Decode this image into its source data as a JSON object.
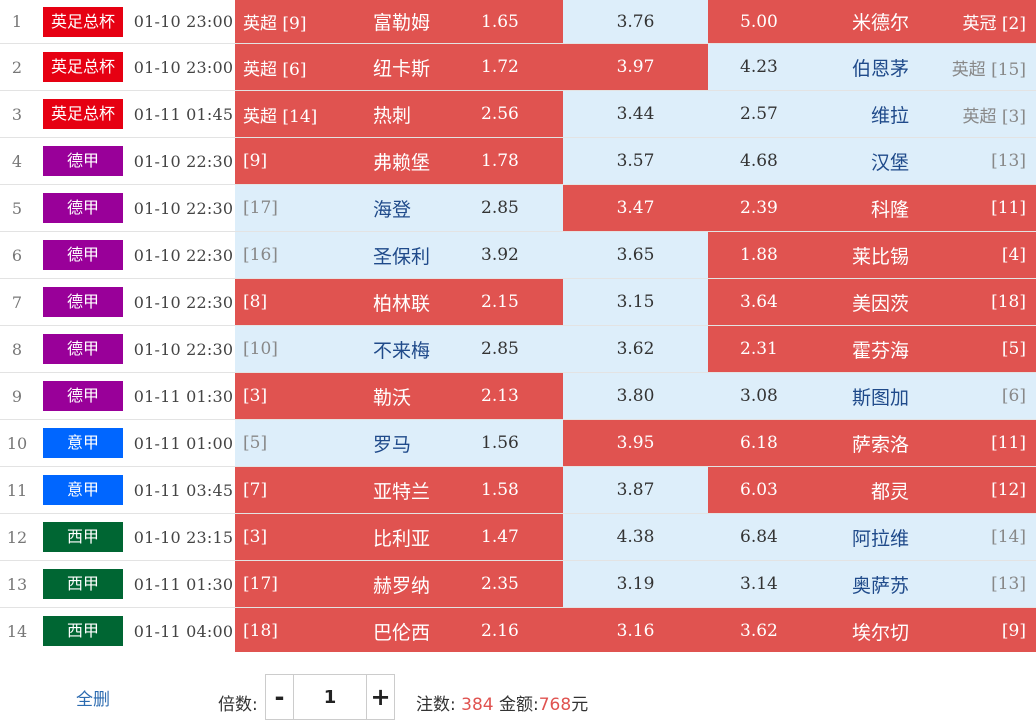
{
  "colors": {
    "highlight_red": "#e05350",
    "light_blue": "#ddeefa",
    "league": {
      "英足总杯": "#e60012",
      "德甲": "#990099",
      "意甲": "#0066ff",
      "西甲": "#006633"
    }
  },
  "matches": [
    {
      "num": "1",
      "league": "英足总杯",
      "time": "01-10 23:00",
      "home_rank": "英超 [9]",
      "home_team": "富勒姆",
      "home_odds": "1.65",
      "draw_odds": "3.76",
      "away_odds": "5.00",
      "away_team": "米德尔",
      "away_rank": "英冠 [2]",
      "home_sel": true,
      "draw_sel": false,
      "away_sel": true
    },
    {
      "num": "2",
      "league": "英足总杯",
      "time": "01-10 23:00",
      "home_rank": "英超 [6]",
      "home_team": "纽卡斯",
      "home_odds": "1.72",
      "draw_odds": "3.97",
      "away_odds": "4.23",
      "away_team": "伯恩茅",
      "away_rank": "英超 [15]",
      "home_sel": true,
      "draw_sel": true,
      "away_sel": false
    },
    {
      "num": "3",
      "league": "英足总杯",
      "time": "01-11 01:45",
      "home_rank": "英超 [14]",
      "home_team": "热刺",
      "home_odds": "2.56",
      "draw_odds": "3.44",
      "away_odds": "2.57",
      "away_team": "维拉",
      "away_rank": "英超 [3]",
      "home_sel": true,
      "draw_sel": false,
      "away_sel": false
    },
    {
      "num": "4",
      "league": "德甲",
      "time": "01-10 22:30",
      "home_rank": "[9]",
      "home_team": "弗赖堡",
      "home_odds": "1.78",
      "draw_odds": "3.57",
      "away_odds": "4.68",
      "away_team": "汉堡",
      "away_rank": "[13]",
      "home_sel": true,
      "draw_sel": false,
      "away_sel": false
    },
    {
      "num": "5",
      "league": "德甲",
      "time": "01-10 22:30",
      "home_rank": "[17]",
      "home_team": "海登",
      "home_odds": "2.85",
      "draw_odds": "3.47",
      "away_odds": "2.39",
      "away_team": "科隆",
      "away_rank": "[11]",
      "home_sel": false,
      "draw_sel": true,
      "away_sel": true
    },
    {
      "num": "6",
      "league": "德甲",
      "time": "01-10 22:30",
      "home_rank": "[16]",
      "home_team": "圣保利",
      "home_odds": "3.92",
      "draw_odds": "3.65",
      "away_odds": "1.88",
      "away_team": "莱比锡",
      "away_rank": "[4]",
      "home_sel": false,
      "draw_sel": false,
      "away_sel": true
    },
    {
      "num": "7",
      "league": "德甲",
      "time": "01-10 22:30",
      "home_rank": "[8]",
      "home_team": "柏林联",
      "home_odds": "2.15",
      "draw_odds": "3.15",
      "away_odds": "3.64",
      "away_team": "美因茨",
      "away_rank": "[18]",
      "home_sel": true,
      "draw_sel": false,
      "away_sel": true
    },
    {
      "num": "8",
      "league": "德甲",
      "time": "01-10 22:30",
      "home_rank": "[10]",
      "home_team": "不来梅",
      "home_odds": "2.85",
      "draw_odds": "3.62",
      "away_odds": "2.31",
      "away_team": "霍芬海",
      "away_rank": "[5]",
      "home_sel": false,
      "draw_sel": false,
      "away_sel": true
    },
    {
      "num": "9",
      "league": "德甲",
      "time": "01-11 01:30",
      "home_rank": "[3]",
      "home_team": "勒沃",
      "home_odds": "2.13",
      "draw_odds": "3.80",
      "away_odds": "3.08",
      "away_team": "斯图加",
      "away_rank": "[6]",
      "home_sel": true,
      "draw_sel": false,
      "away_sel": false
    },
    {
      "num": "10",
      "league": "意甲",
      "time": "01-11 01:00",
      "home_rank": "[5]",
      "home_team": "罗马",
      "home_odds": "1.56",
      "draw_odds": "3.95",
      "away_odds": "6.18",
      "away_team": "萨索洛",
      "away_rank": "[11]",
      "home_sel": false,
      "draw_sel": true,
      "away_sel": true
    },
    {
      "num": "11",
      "league": "意甲",
      "time": "01-11 03:45",
      "home_rank": "[7]",
      "home_team": "亚特兰",
      "home_odds": "1.58",
      "draw_odds": "3.87",
      "away_odds": "6.03",
      "away_team": "都灵",
      "away_rank": "[12]",
      "home_sel": true,
      "draw_sel": false,
      "away_sel": true
    },
    {
      "num": "12",
      "league": "西甲",
      "time": "01-10 23:15",
      "home_rank": "[3]",
      "home_team": "比利亚",
      "home_odds": "1.47",
      "draw_odds": "4.38",
      "away_odds": "6.84",
      "away_team": "阿拉维",
      "away_rank": "[14]",
      "home_sel": true,
      "draw_sel": false,
      "away_sel": false
    },
    {
      "num": "13",
      "league": "西甲",
      "time": "01-11 01:30",
      "home_rank": "[17]",
      "home_team": "赫罗纳",
      "home_odds": "2.35",
      "draw_odds": "3.19",
      "away_odds": "3.14",
      "away_team": "奥萨苏",
      "away_rank": "[13]",
      "home_sel": true,
      "draw_sel": false,
      "away_sel": false
    },
    {
      "num": "14",
      "league": "西甲",
      "time": "01-11 04:00",
      "home_rank": "[18]",
      "home_team": "巴伦西",
      "home_odds": "2.16",
      "draw_odds": "3.16",
      "away_odds": "3.62",
      "away_team": "埃尔切",
      "away_rank": "[9]",
      "home_sel": true,
      "draw_sel": true,
      "away_sel": true
    }
  ],
  "footer": {
    "clear_label": "全删",
    "multiplier_label": "倍数:",
    "minus_label": "-",
    "plus_label": "+",
    "multiplier_value": "1",
    "bets_label": "注数:",
    "bets_value": "384",
    "amount_label": "金额:",
    "amount_value": "768",
    "currency": "元"
  }
}
